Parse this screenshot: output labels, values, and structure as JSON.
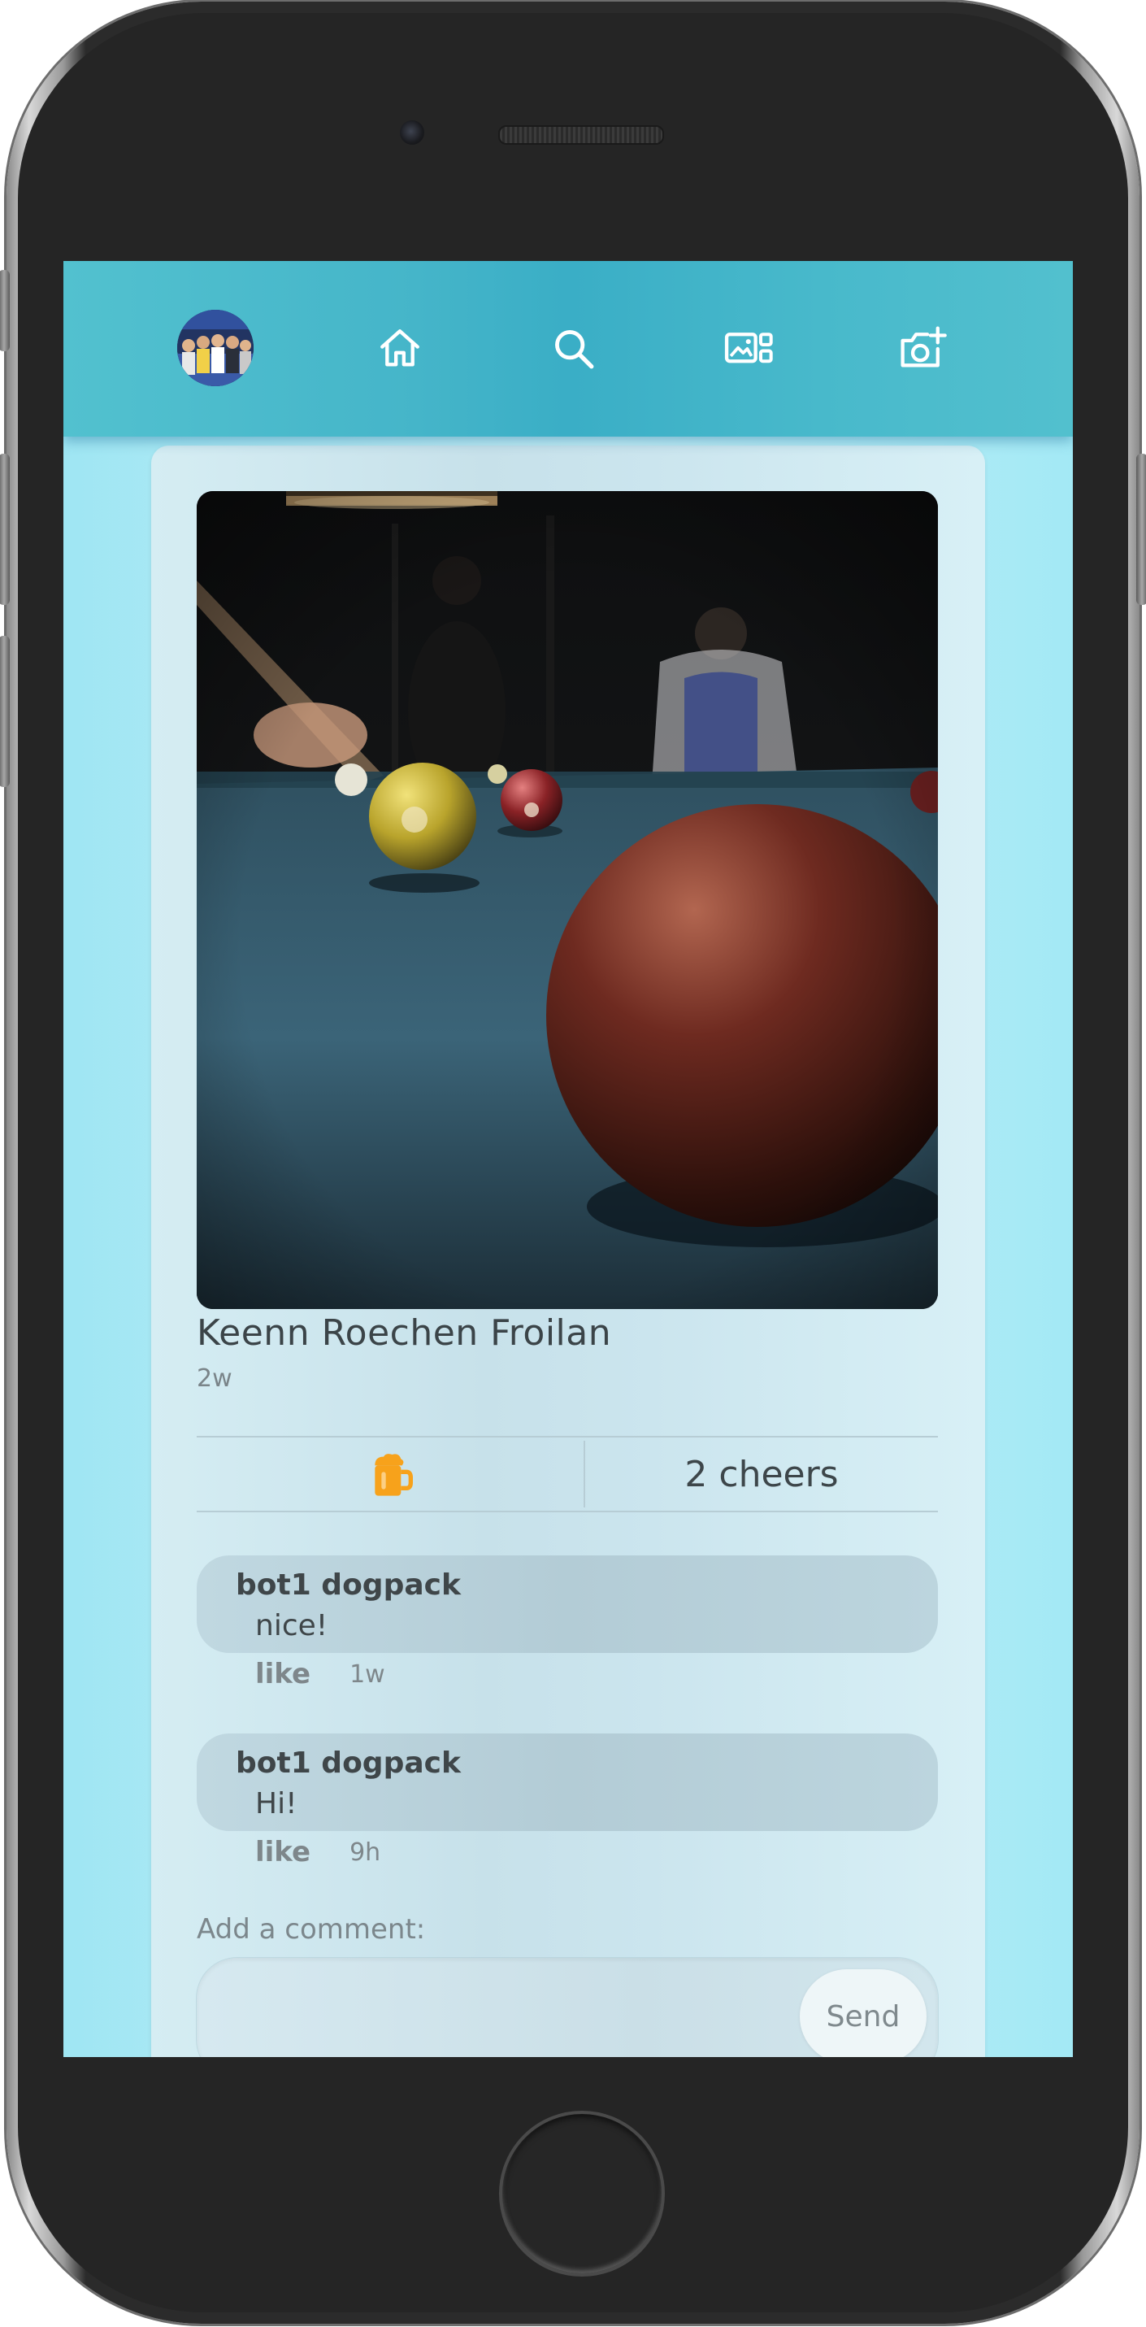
{
  "nav": {
    "icons": [
      "avatar",
      "home-icon",
      "search-icon",
      "gallery-icon",
      "add-photo-icon"
    ]
  },
  "post": {
    "author": "Keenn Roechen Froilan",
    "time": "2w",
    "cheers_label": "2 cheers",
    "cheer_icon": "beer-mug-icon",
    "cheer_icon_color": "#f7a21b"
  },
  "comments": [
    {
      "name": "bot1 dogpack",
      "text": "nice!",
      "like": "like",
      "time": "1w"
    },
    {
      "name": "bot1 dogpack",
      "text": "Hi!",
      "like": "like",
      "time": "9h"
    }
  ],
  "composer": {
    "label": "Add a comment:",
    "placeholder": "",
    "send_label": "Send"
  },
  "colors": {
    "topbar": "#45b5c9",
    "screen_bg": "#a3e9f5",
    "card_bg": "#cbe5ee"
  }
}
